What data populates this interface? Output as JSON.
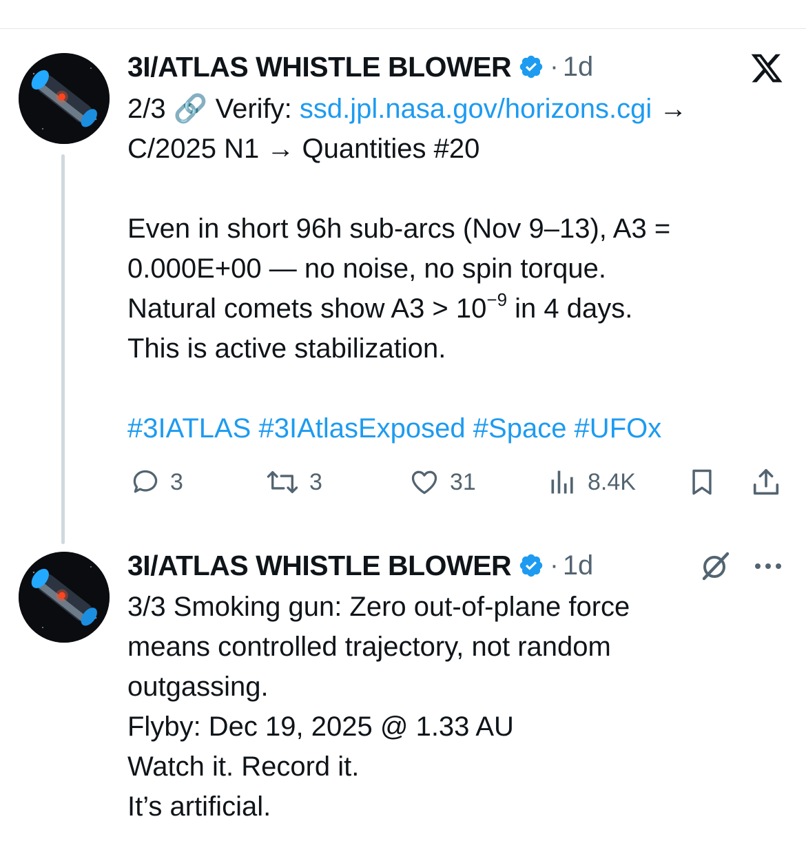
{
  "tweets": [
    {
      "author": "3I/ATLAS WHISTLE BLOWER",
      "dot": "·",
      "time": "1d",
      "lines": {
        "l1_prefix": "2/3 🔗 Verify: ",
        "l1_link": "ssd.jpl.nasa.gov/horizons.cgi",
        "l1_suffix": " →",
        "l2": "C/2025 N1 → Quantities #20",
        "l3": "Even in short 96h sub-arcs (Nov 9–13), A3 =",
        "l4": "0.000E+00 — no noise, no spin torque.",
        "l5_prefix": "Natural comets show A3 > 10",
        "l5_sup": "−9",
        "l5_suffix": " in 4 days.",
        "l6": "This is active stabilization.",
        "hashtags": "#3IATLAS #3IAtlasExposed #Space #UFOx"
      },
      "stats": {
        "replies": "3",
        "reposts": "3",
        "likes": "31",
        "views": "8.4K"
      }
    },
    {
      "author": "3I/ATLAS WHISTLE BLOWER",
      "dot": "·",
      "time": "1d",
      "lines": [
        "3/3 Smoking gun: Zero out-of-plane force",
        "means controlled trajectory, not random",
        "outgassing.",
        "Flyby: Dec 19, 2025 @ 1.33 AU",
        "Watch it. Record it.",
        "It’s artificial."
      ]
    }
  ],
  "colors": {
    "accent": "#1d9bf0",
    "secondary": "#536471",
    "text": "#0f1419",
    "thread": "#cfd9de"
  },
  "icons": [
    "verified-icon",
    "x-logo-icon",
    "reply-icon",
    "repost-icon",
    "like-icon",
    "views-icon",
    "bookmark-icon",
    "share-icon",
    "grok-icon",
    "more-icon"
  ]
}
